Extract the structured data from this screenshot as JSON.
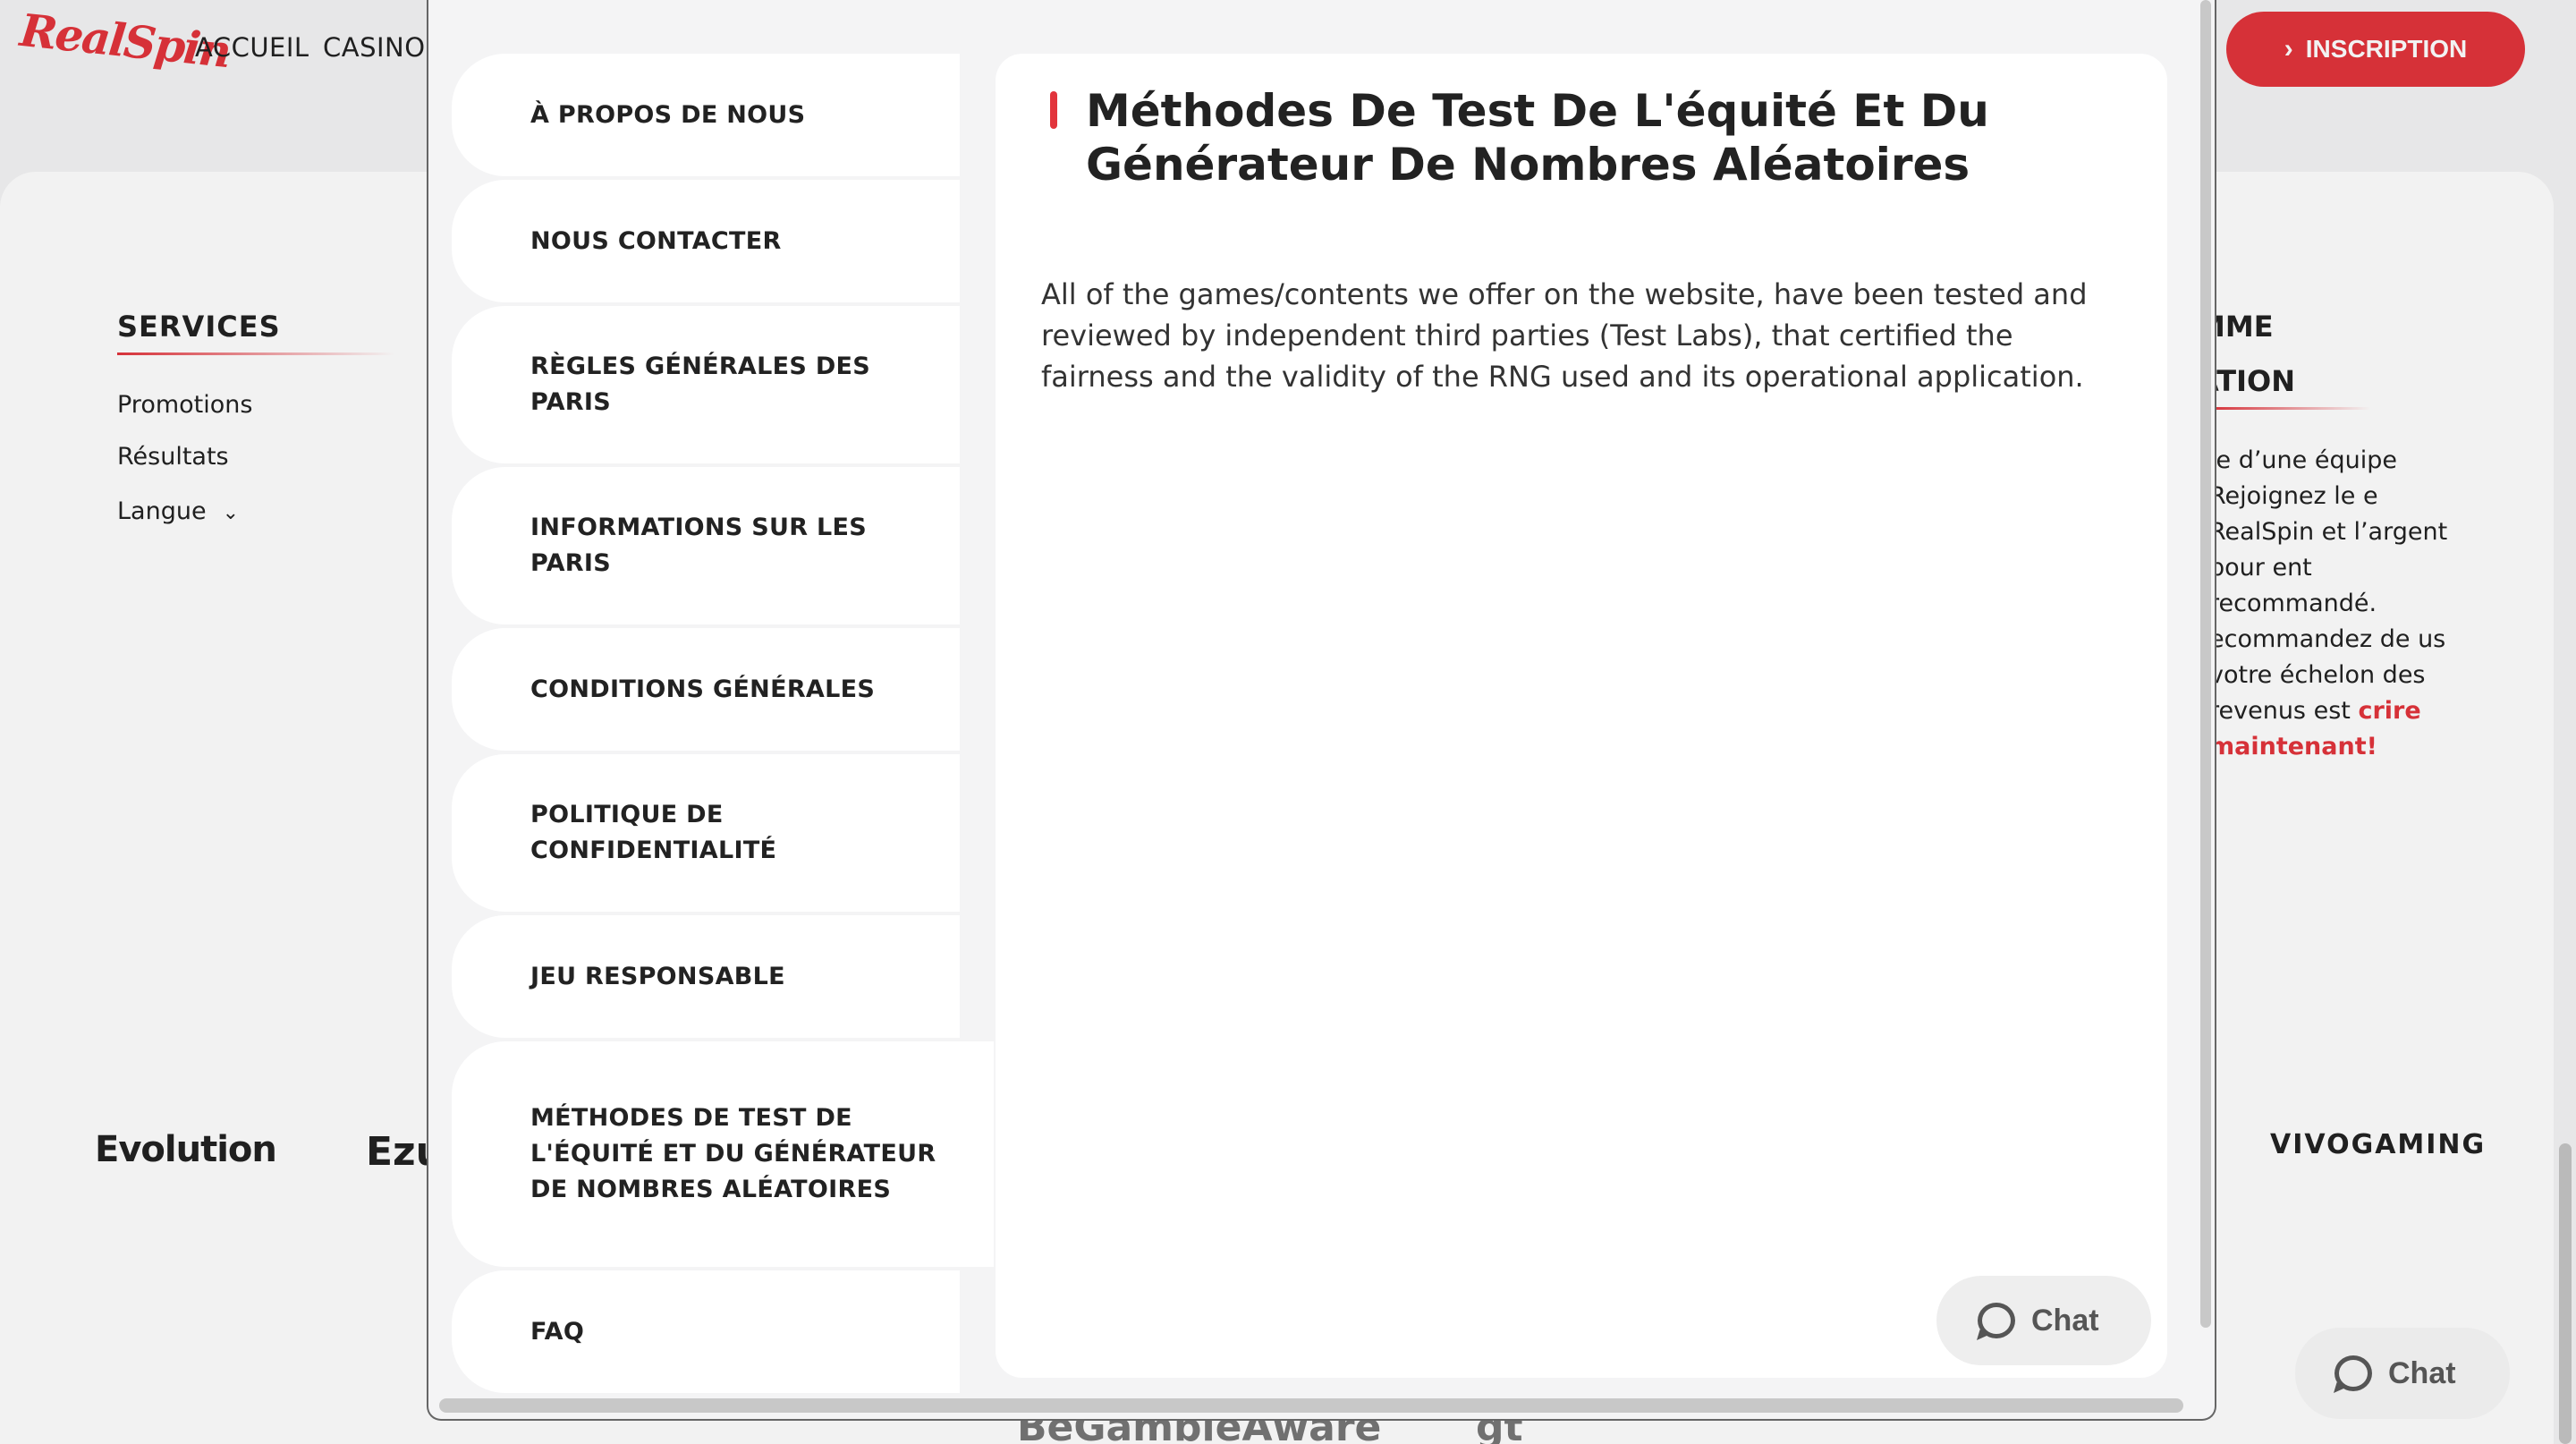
{
  "header": {
    "logo_text": "RealSpin",
    "nav": [
      "ACCUEIL",
      "CASINO"
    ],
    "signup_label": "INSCRIPTION"
  },
  "footer": {
    "services_title": "SERVICES",
    "links": [
      "Promotions",
      "Résultats",
      "Langue"
    ],
    "right_title_1": "MME",
    "right_title_2": "ATION",
    "right_text": "ie d’une équipe Rejoignez le e RealSpin et l’argent pour ent recommandé. ecommandez de us votre échelon des revenus est",
    "right_cta": "crire maintenant!",
    "providers": [
      "Evolution",
      "Ezu",
      "VIVOGAMING"
    ],
    "bottom_logos": [
      "BeGambleAware",
      "gt"
    ]
  },
  "modal": {
    "menu": [
      "À PROPOS DE NOUS",
      "NOUS CONTACTER",
      "RÈGLES GÉNÉRALES DES PARIS",
      "INFORMATIONS SUR LES PARIS",
      "CONDITIONS GÉNÉRALES",
      "POLITIQUE DE CONFIDENTIALITÉ",
      "JEU RESPONSABLE",
      "MÉTHODES DE TEST DE L'ÉQUITÉ ET DU GÉNÉRATEUR DE NOMBRES ALÉATOIRES",
      "FAQ"
    ],
    "active_index": 7,
    "title": "Méthodes De Test De L'équité Et Du Générateur De Nombres Aléatoires",
    "body": "All of the games/contents we offer on the website, have been tested and reviewed by independent third parties (Test Labs), that certified the fairness and the validity of the RNG used and its operational application."
  },
  "chat_label": "Chat",
  "colors": {
    "brand_red": "#e2343c",
    "bg": "#f4f4f5"
  }
}
